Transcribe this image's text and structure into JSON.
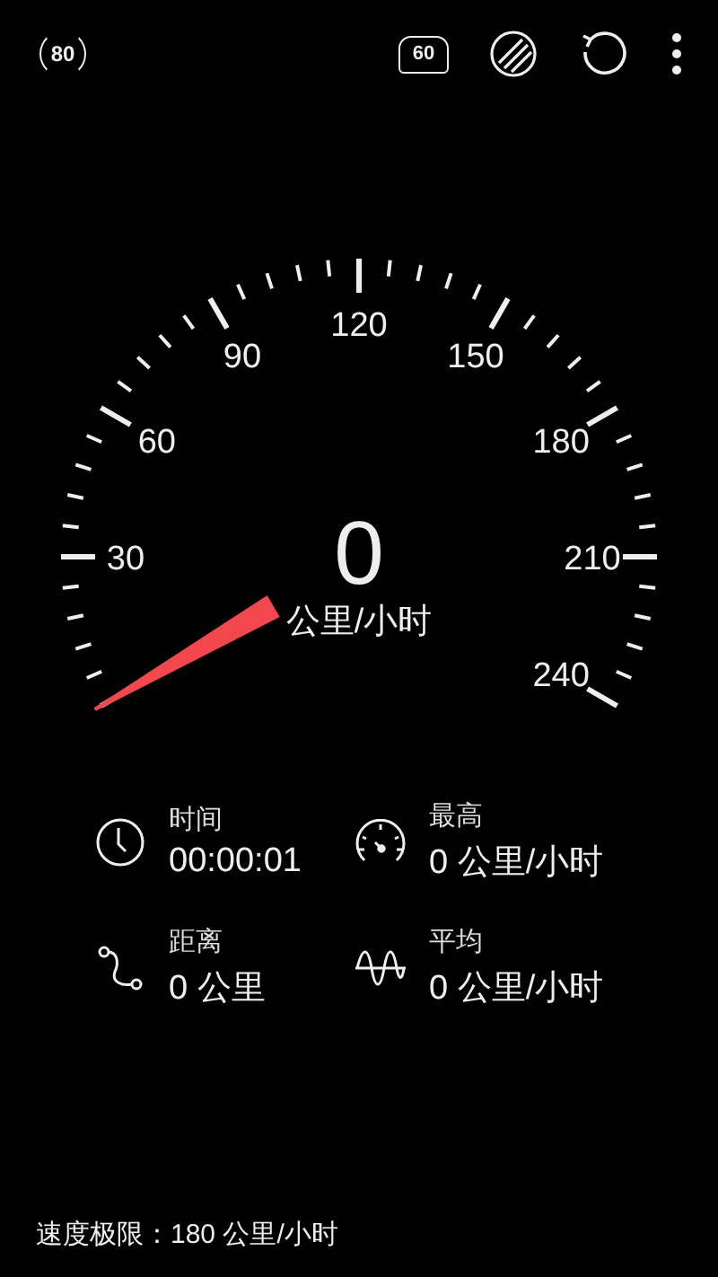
{
  "toolbar": {
    "limit_badge": "80",
    "preset_badge": "60"
  },
  "gauge": {
    "tick_labels": [
      "30",
      "60",
      "90",
      "120",
      "150",
      "180",
      "210",
      "240"
    ],
    "speed": "0",
    "unit": "公里/小时"
  },
  "stats": [
    {
      "kind": "clock",
      "label": "时间",
      "value": "00:00:01"
    },
    {
      "kind": "speedometer",
      "label": "最高",
      "value": "0 公里/小时"
    },
    {
      "kind": "route",
      "label": "距离",
      "value": "0 公里"
    },
    {
      "kind": "wave",
      "label": "平均",
      "value": "0 公里/小时"
    }
  ],
  "footer": {
    "speed_limit": "速度极限：180 公里/小时"
  }
}
